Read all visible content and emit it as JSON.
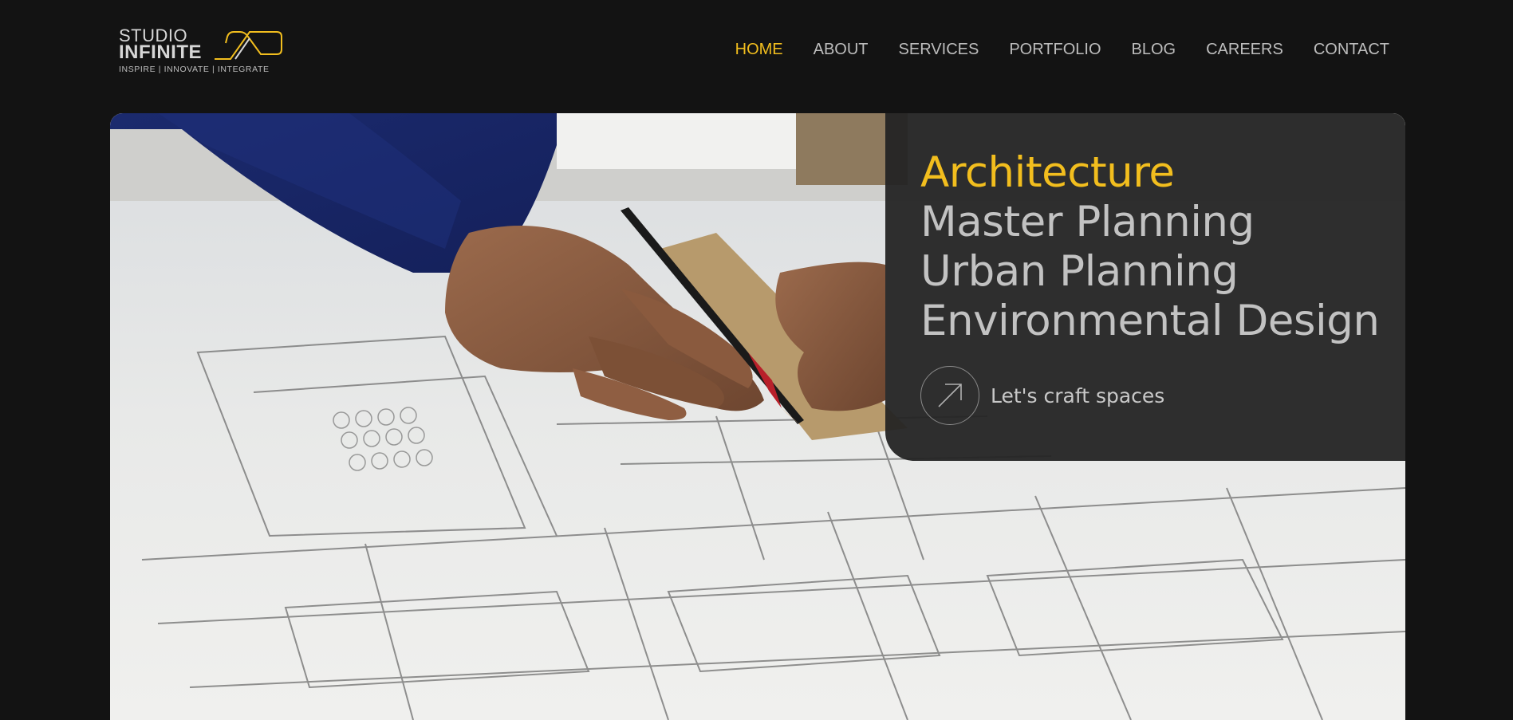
{
  "brand": {
    "name_line1": "STUDIO",
    "name_line2": "INFINITE",
    "tagline": "INSPIRE  |  INNOVATE  |  INTEGRATE",
    "accent_color": "#f2be1e"
  },
  "nav": {
    "items": [
      {
        "label": "HOME",
        "active": true
      },
      {
        "label": "ABOUT",
        "active": false
      },
      {
        "label": "SERVICES",
        "active": false
      },
      {
        "label": "PORTFOLIO",
        "active": false
      },
      {
        "label": "BLOG",
        "active": false
      },
      {
        "label": "CAREERS",
        "active": false
      },
      {
        "label": "CONTACT",
        "active": false
      }
    ]
  },
  "hero": {
    "services": [
      "Architecture",
      "Master Planning",
      "Urban Planning",
      "Environmental Design"
    ],
    "cta_label": "Let's craft spaces",
    "cta_icon": "arrow-up-right-icon",
    "image": "architect-drawing-blueprint"
  }
}
